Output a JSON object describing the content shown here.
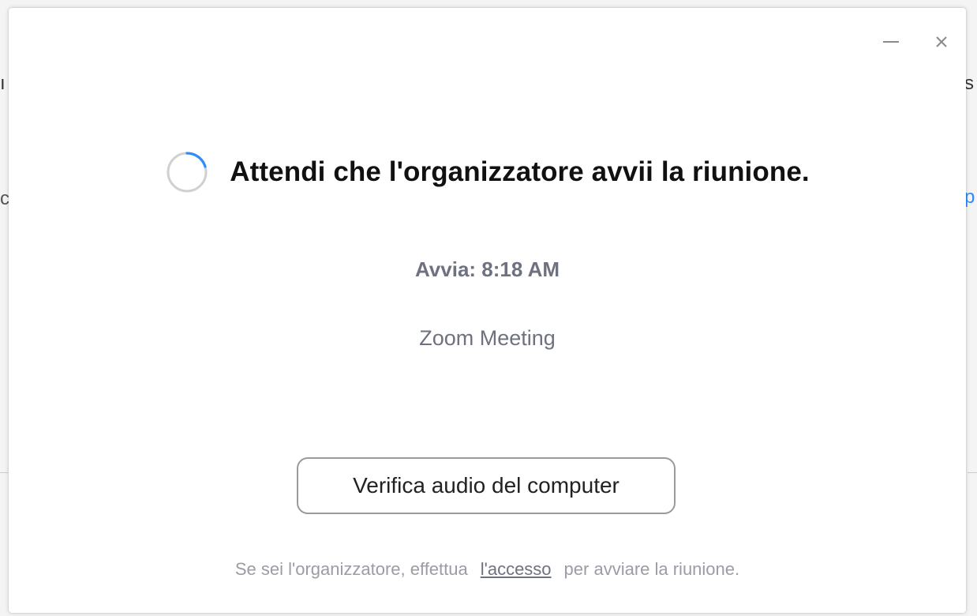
{
  "background": {
    "left_top": "ı",
    "left_mid": "c",
    "right_top": "s",
    "right_mid": "p"
  },
  "window": {
    "minimize_icon": "minimize-icon",
    "close_icon": "close-icon"
  },
  "main": {
    "spinner_icon": "loading-spinner-icon",
    "heading": "Attendi che l'organizzatore avvii la riunione.",
    "start_time": "Avvia: 8:18 AM",
    "meeting_name": "Zoom Meeting"
  },
  "actions": {
    "audio_button_label": "Verifica audio del computer"
  },
  "footer": {
    "text_before": "Se sei l'organizzatore, effettua",
    "link_label": "l'accesso",
    "text_after": "per avviare la riunione."
  },
  "colors": {
    "spinner_accent": "#2d8cff",
    "spinner_track": "#d0d0d0",
    "heading": "#111111",
    "secondary_text": "#6e7180",
    "footer_text": "#9a9ca6"
  }
}
